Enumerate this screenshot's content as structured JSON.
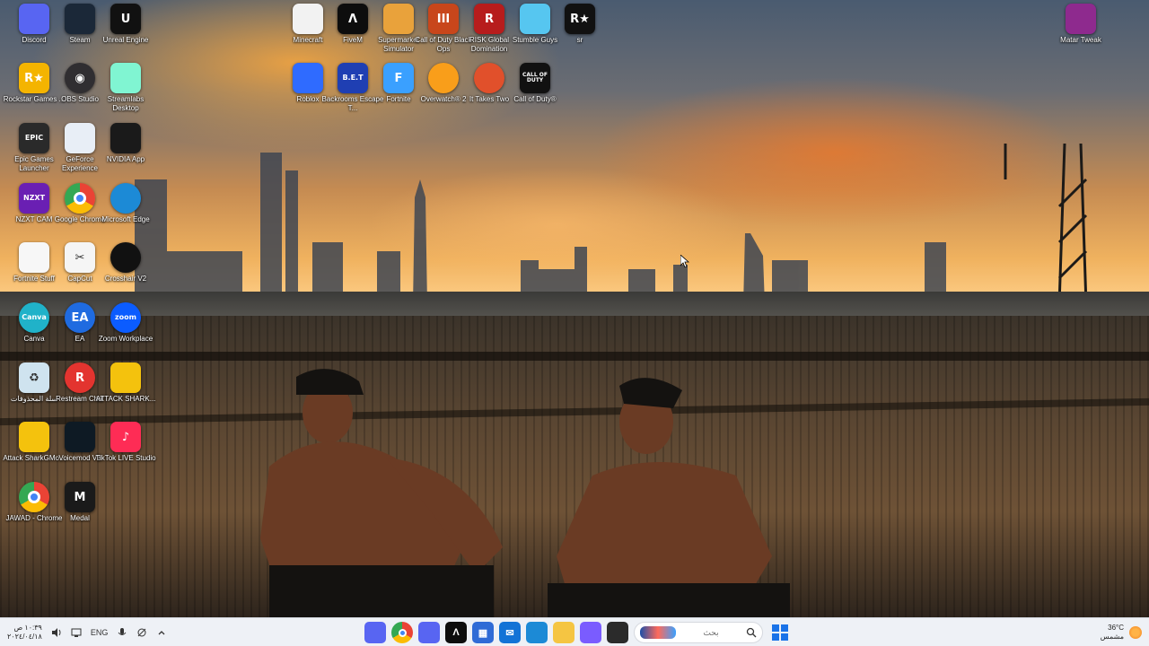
{
  "desktop_icons": [
    {
      "id": "discord",
      "label": "Discord",
      "glyph": "",
      "color": "#5865F2",
      "icon": "discord-icon"
    },
    {
      "id": "steam",
      "label": "Steam",
      "glyph": "",
      "color": "#1b2838",
      "icon": "steam-icon"
    },
    {
      "id": "unreal",
      "label": "Unreal Engine",
      "glyph": "U",
      "color": "#111111",
      "icon": "unreal-engine-icon"
    },
    {
      "id": "minecraft",
      "label": "Minecraft",
      "glyph": "",
      "color": "#f2f2f2",
      "icon": "file-icon"
    },
    {
      "id": "fivem",
      "label": "FiveM",
      "glyph": "Λ",
      "color": "#0d0d0d",
      "icon": "fivem-icon"
    },
    {
      "id": "supermarket",
      "label": "Supermarket Simulator",
      "glyph": "",
      "color": "#e9a23b",
      "icon": "supermarket-simulator-icon"
    },
    {
      "id": "cod-bo",
      "label": "Call of Duty Black Ops",
      "glyph": "III",
      "color": "#c8461b",
      "icon": "call-of-duty-black-ops-icon"
    },
    {
      "id": "risk",
      "label": "RISK Global Domination",
      "glyph": "R",
      "color": "#b71c1c",
      "icon": "risk-icon"
    },
    {
      "id": "stumble",
      "label": "Stumble Guys",
      "glyph": "",
      "color": "#56c6f0",
      "icon": "stumble-guys-icon"
    },
    {
      "id": "r-star",
      "label": "sr",
      "glyph": "R★",
      "color": "#111111",
      "icon": "rockstar-icon"
    },
    {
      "id": "matar",
      "label": "Matar Tweak",
      "glyph": "",
      "color": "#8e2a8e",
      "icon": "winrar-icon"
    },
    {
      "id": "rockstar",
      "label": "Rockstar Games ...",
      "glyph": "R★",
      "color": "#f4b400",
      "icon": "rockstar-games-icon"
    },
    {
      "id": "obs",
      "label": "OBS Studio",
      "glyph": "◉",
      "color": "#302e31",
      "icon": "obs-icon"
    },
    {
      "id": "streamlabs",
      "label": "Streamlabs Desktop",
      "glyph": "",
      "color": "#80f5d2",
      "icon": "streamlabs-icon"
    },
    {
      "id": "roblox",
      "label": "Roblox",
      "glyph": "",
      "color": "#2f6bff",
      "icon": "roblox-icon"
    },
    {
      "id": "backrooms",
      "label": "Backrooms Escape T...",
      "glyph": "B.E.T",
      "color": "#1f3fb3",
      "icon": "backrooms-icon"
    },
    {
      "id": "fortnite",
      "label": "Fortnite",
      "glyph": "F",
      "color": "#3aa0ff",
      "icon": "fortnite-icon"
    },
    {
      "id": "overwatch",
      "label": "Overwatch® 2",
      "glyph": "",
      "color": "#f99e1a",
      "icon": "overwatch-icon"
    },
    {
      "id": "ittakestwo",
      "label": "It Takes Two",
      "glyph": "",
      "color": "#e1502b",
      "icon": "it-takes-two-icon"
    },
    {
      "id": "cod",
      "label": "Call of Duty®",
      "glyph": "CALL OF DUTY",
      "color": "#111111",
      "icon": "call-of-duty-icon"
    },
    {
      "id": "epic",
      "label": "Epic Games Launcher",
      "glyph": "EPIC",
      "color": "#2a2a2a",
      "icon": "epic-games-icon"
    },
    {
      "id": "geforce",
      "label": "GeForce Experience",
      "glyph": "",
      "color": "#e8eef6",
      "icon": "geforce-experience-icon"
    },
    {
      "id": "nvidia",
      "label": "NVIDIA App",
      "glyph": "",
      "color": "#1a1a1a",
      "icon": "nvidia-icon"
    },
    {
      "id": "nzxt",
      "label": "NZXT CAM",
      "glyph": "NZXT",
      "color": "#6a1fb3",
      "icon": "nzxt-icon"
    },
    {
      "id": "chrome1",
      "label": "Google Chrome",
      "glyph": "",
      "color": "#ffffff",
      "icon": "chrome-icon"
    },
    {
      "id": "edge",
      "label": "Microsoft Edge",
      "glyph": "",
      "color": "#1c8ad6",
      "icon": "edge-icon"
    },
    {
      "id": "fortnite-file",
      "label": "Fortnite Stuff",
      "glyph": "",
      "color": "#f7f7f7",
      "icon": "file-icon"
    },
    {
      "id": "capcut",
      "label": "CapCut",
      "glyph": "✂",
      "color": "#f5f5f5",
      "icon": "capcut-icon"
    },
    {
      "id": "overlay",
      "label": "Crosshair V2",
      "glyph": "",
      "color": "#111111",
      "icon": "crosshair-icon"
    },
    {
      "id": "canva",
      "label": "Canva",
      "glyph": "Canva",
      "color": "#20b2c9",
      "icon": "canva-icon"
    },
    {
      "id": "ea",
      "label": "EA",
      "glyph": "EA",
      "color": "#1f6be0",
      "icon": "ea-icon"
    },
    {
      "id": "zoom",
      "label": "Zoom Workplace",
      "glyph": "zoom",
      "color": "#0b5cff",
      "icon": "zoom-icon"
    },
    {
      "id": "recycle",
      "label": "سلة المحذوفات",
      "glyph": "♻",
      "color": "#cfe3ef",
      "icon": "recycle-bin-icon"
    },
    {
      "id": "restream",
      "label": "Restream Chat",
      "glyph": "R",
      "color": "#e3342f",
      "icon": "restream-icon"
    },
    {
      "id": "attack-shark",
      "label": "ATTACK SHARK...",
      "glyph": "",
      "color": "#f4c20d",
      "icon": "attack-shark-icon"
    },
    {
      "id": "attack-shark2",
      "label": "Attack SharkGMo...",
      "glyph": "",
      "color": "#f4c20d",
      "icon": "attack-shark-icon"
    },
    {
      "id": "voicemod",
      "label": "Voicemod V3",
      "glyph": "",
      "color": "#0e1a24",
      "icon": "voicemod-icon"
    },
    {
      "id": "tiktok",
      "label": "TikTok LIVE Studio",
      "glyph": "♪",
      "color": "#fe2c55",
      "icon": "tiktok-icon"
    },
    {
      "id": "chrome2",
      "label": "JAWAD - Chrome",
      "glyph": "",
      "color": "#ffffff",
      "icon": "chrome-icon"
    },
    {
      "id": "medal",
      "label": "Medal",
      "glyph": "M",
      "color": "#1a1a1a",
      "icon": "medal-icon"
    }
  ],
  "taskbar": {
    "clock_time": "١٠:٣٩ ص",
    "clock_date": "٢٠٢٤/٠٤/١٨",
    "language": "ENG",
    "search_placeholder": "بحث",
    "weather_temp": "36°C",
    "weather_desc": "مشمس",
    "apps": [
      {
        "id": "tb-discord",
        "color": "#5865F2",
        "glyph": "",
        "icon": "streamlabs-taskbar-icon"
      },
      {
        "id": "tb-chrome",
        "color": "#ffffff",
        "glyph": "",
        "icon": "chrome-taskbar-icon"
      },
      {
        "id": "tb-discord2",
        "color": "#5865F2",
        "glyph": "",
        "icon": "discord-taskbar-icon"
      },
      {
        "id": "tb-fivem",
        "color": "#0d0d0d",
        "glyph": "Λ",
        "icon": "fivem-taskbar-icon"
      },
      {
        "id": "tb-store",
        "color": "#2f6bd6",
        "glyph": "▦",
        "icon": "store-taskbar-icon"
      },
      {
        "id": "tb-outlook",
        "color": "#1373d6",
        "glyph": "✉",
        "icon": "mail-taskbar-icon"
      },
      {
        "id": "tb-edge",
        "color": "#1c8ad6",
        "glyph": "",
        "icon": "edge-taskbar-icon"
      },
      {
        "id": "tb-explorer",
        "color": "#f5c542",
        "glyph": "",
        "icon": "file-explorer-taskbar-icon"
      },
      {
        "id": "tb-copilot",
        "color": "#7a5cff",
        "glyph": "",
        "icon": "copilot-taskbar-icon"
      },
      {
        "id": "tb-terminal",
        "color": "#2b2b2b",
        "glyph": "",
        "icon": "task-view-taskbar-icon"
      }
    ]
  }
}
